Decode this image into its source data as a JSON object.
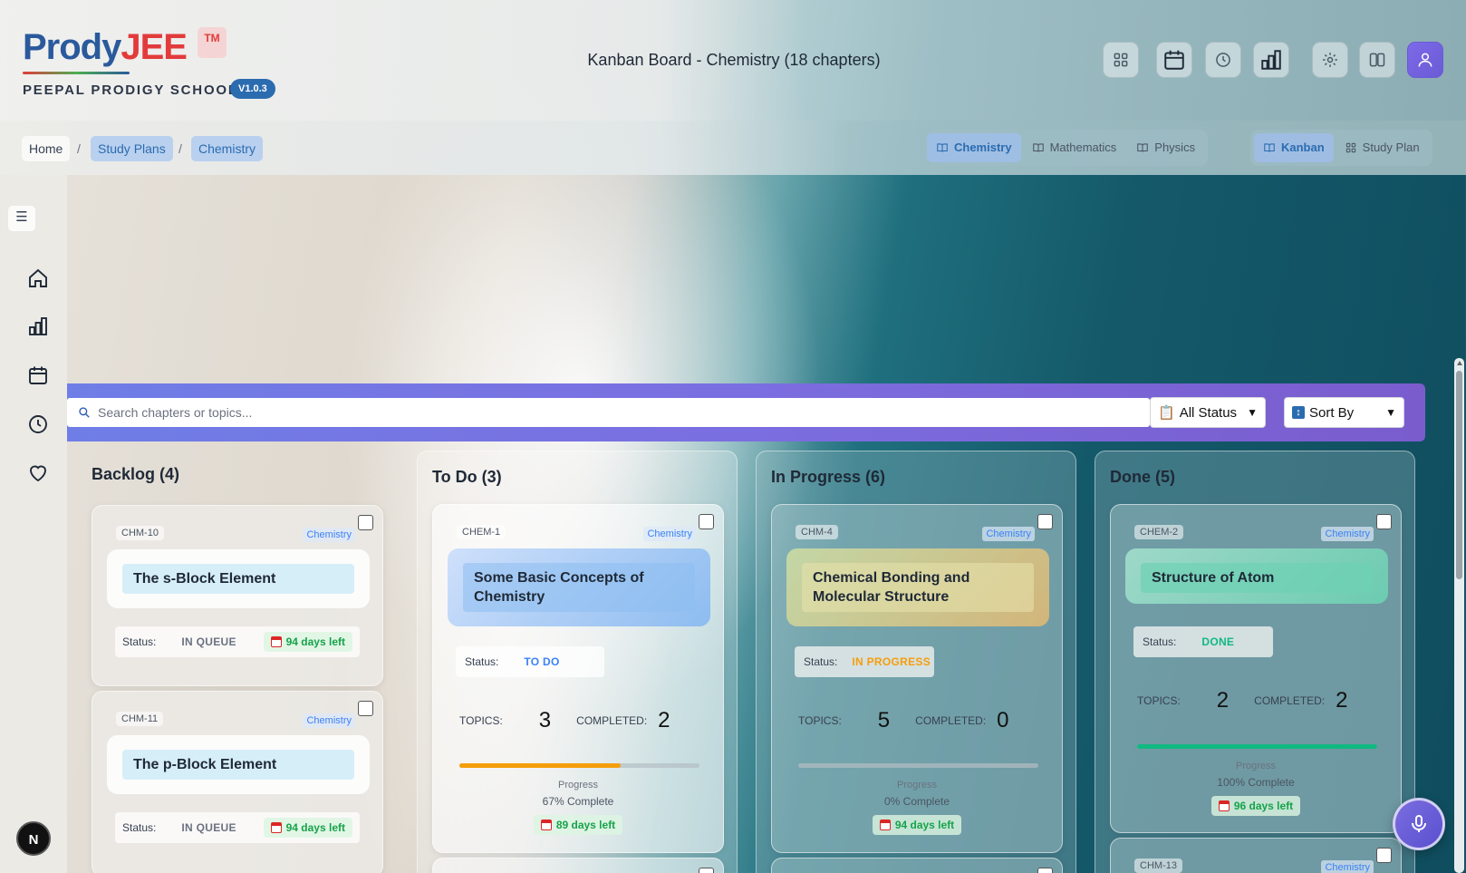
{
  "brand": {
    "name_part1": "Prody",
    "name_part2": "JEE",
    "tm": "TM",
    "school": "PEEPAL PRODIGY SCHOOL",
    "version": "V1.0.3"
  },
  "header": {
    "title": "Kanban Board - Chemistry (18 chapters)",
    "icons": [
      "grid-icon",
      "calendar-icon",
      "clock-icon",
      "bar-chart-icon",
      "gear-icon",
      "columns-icon",
      "user-icon"
    ]
  },
  "breadcrumb": {
    "home": "Home",
    "study_plans": "Study Plans",
    "current": "Chemistry",
    "sep": "/"
  },
  "subjects": {
    "tabs": [
      "Chemistry",
      "Mathematics",
      "Physics"
    ],
    "active": "Chemistry"
  },
  "views": {
    "tabs": [
      "Kanban",
      "Study Plan"
    ],
    "active": "Kanban"
  },
  "sidebar": {
    "toggle": "☰",
    "icons": [
      "home-icon",
      "bar-chart-icon",
      "calendar-icon",
      "clock-icon",
      "heart-icon"
    ],
    "badge": "N"
  },
  "filters": {
    "search_placeholder": "Search chapters or topics...",
    "status": "All Status",
    "sort": "Sort By"
  },
  "labels": {
    "status": "Status:",
    "topics": "TOPICS:",
    "completed": "COMPLETED:",
    "progress": "Progress"
  },
  "columns": {
    "backlog": {
      "title": "Backlog (4)",
      "cards": [
        {
          "id": "CHM-10",
          "subject": "Chemistry",
          "title": "The s-Block Element",
          "status": "IN QUEUE",
          "days": "94 days left"
        },
        {
          "id": "CHM-11",
          "subject": "Chemistry",
          "title": "The p-Block Element",
          "status": "IN QUEUE",
          "days": "94 days left"
        }
      ]
    },
    "todo": {
      "title": "To Do (3)",
      "cards": [
        {
          "id": "CHEM-1",
          "subject": "Chemistry",
          "title": "Some Basic Concepts of Chemistry",
          "status": "TO DO",
          "topics": "3",
          "completed": "2",
          "progress": 0.67,
          "progress_text": "67% Complete",
          "days": "89 days left"
        }
      ]
    },
    "inprogress": {
      "title": "In Progress (6)",
      "cards": [
        {
          "id": "CHM-4",
          "subject": "Chemistry",
          "title": "Chemical Bonding and Molecular Structure",
          "status": "IN PROGRESS",
          "topics": "5",
          "completed": "0",
          "progress": 0,
          "progress_text": "0% Complete",
          "days": "94 days left"
        }
      ]
    },
    "done": {
      "title": "Done (5)",
      "cards": [
        {
          "id": "CHEM-2",
          "subject": "Chemistry",
          "title": "Structure of Atom",
          "status": "DONE",
          "topics": "2",
          "completed": "2",
          "progress": 1,
          "progress_text": "100% Complete",
          "days": "96 days left"
        },
        {
          "id": "CHM-13",
          "subject": "Chemistry"
        }
      ]
    }
  },
  "colors": {
    "todo": "#3b82f6",
    "inprogress": "#f59e0b",
    "done": "#10b981",
    "queue": "#6b7280"
  }
}
